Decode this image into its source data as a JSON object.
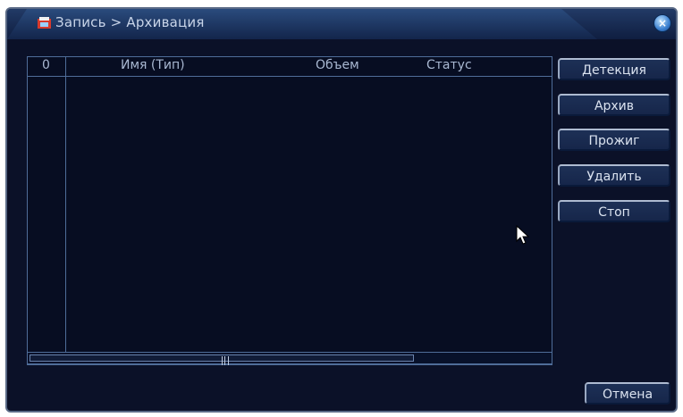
{
  "window": {
    "title": "Запись > Архивация",
    "close_label": "×"
  },
  "table": {
    "columns": [
      "0",
      "Имя (Тип)",
      "Объем",
      "Статус"
    ],
    "rows": []
  },
  "actions": {
    "detect": "Детекция",
    "archive": "Архив",
    "burn": "Прожиг",
    "delete": "Удалить",
    "stop": "Стоп",
    "cancel": "Отмена"
  },
  "colors": {
    "background": "#0b1128",
    "border": "#4f6d99",
    "text": "#dbe3f0"
  }
}
